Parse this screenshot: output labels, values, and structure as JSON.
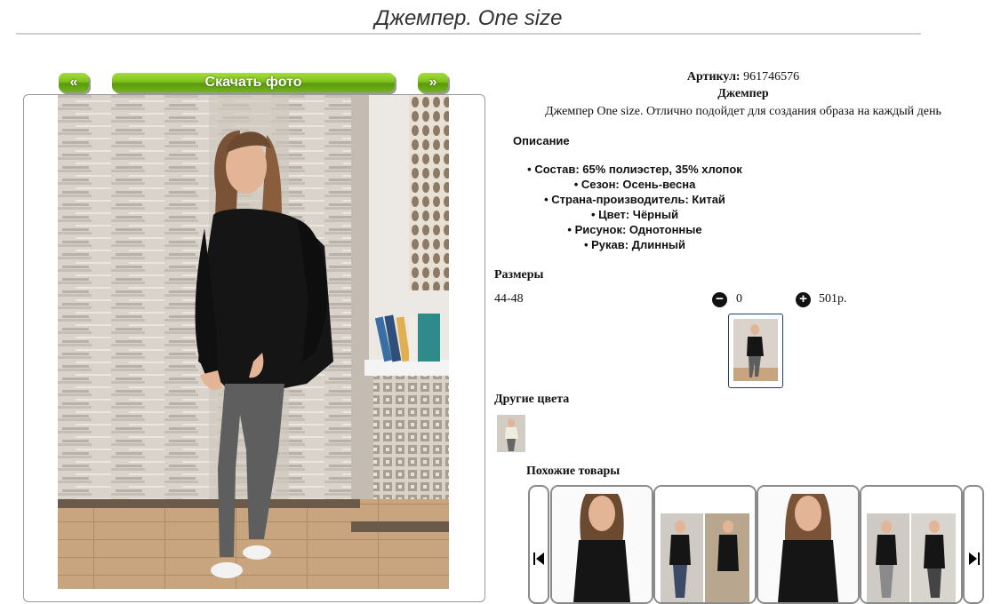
{
  "page": {
    "title": "Джемпер. One size"
  },
  "gallery": {
    "prev_label": "«",
    "download_label": "Скачать фото",
    "next_label": "»"
  },
  "product": {
    "article_label": "Артикул:",
    "article_value": "961746576",
    "name": "Джемпер",
    "tagline": "Джемпер One size. Отлично подойдет для создания образа на каждый день",
    "description_heading": "Описание",
    "properties": [
      "Состав: 65% полиэстер, 35% хлопок",
      "Сезон: Осень-весна",
      "Страна-производитель: Китай",
      "Цвет: Чёрный",
      "Рисунок: Однотонные",
      "Рукав: Длинный"
    ],
    "bullet": "•"
  },
  "sizes": {
    "heading": "Размеры",
    "row": {
      "size": "44-48",
      "minus": "−",
      "qty": "0",
      "plus": "+",
      "price": "501р."
    }
  },
  "other_colors": {
    "heading": "Другие цвета"
  },
  "similar": {
    "heading": "Похожие товары",
    "prev_icon": "prev-arrow-icon",
    "next_icon": "next-arrow-icon"
  },
  "colors": {
    "accent_green": "#7fc21e",
    "border_gray": "#8a8a8a",
    "sweater_black": "#111111"
  }
}
